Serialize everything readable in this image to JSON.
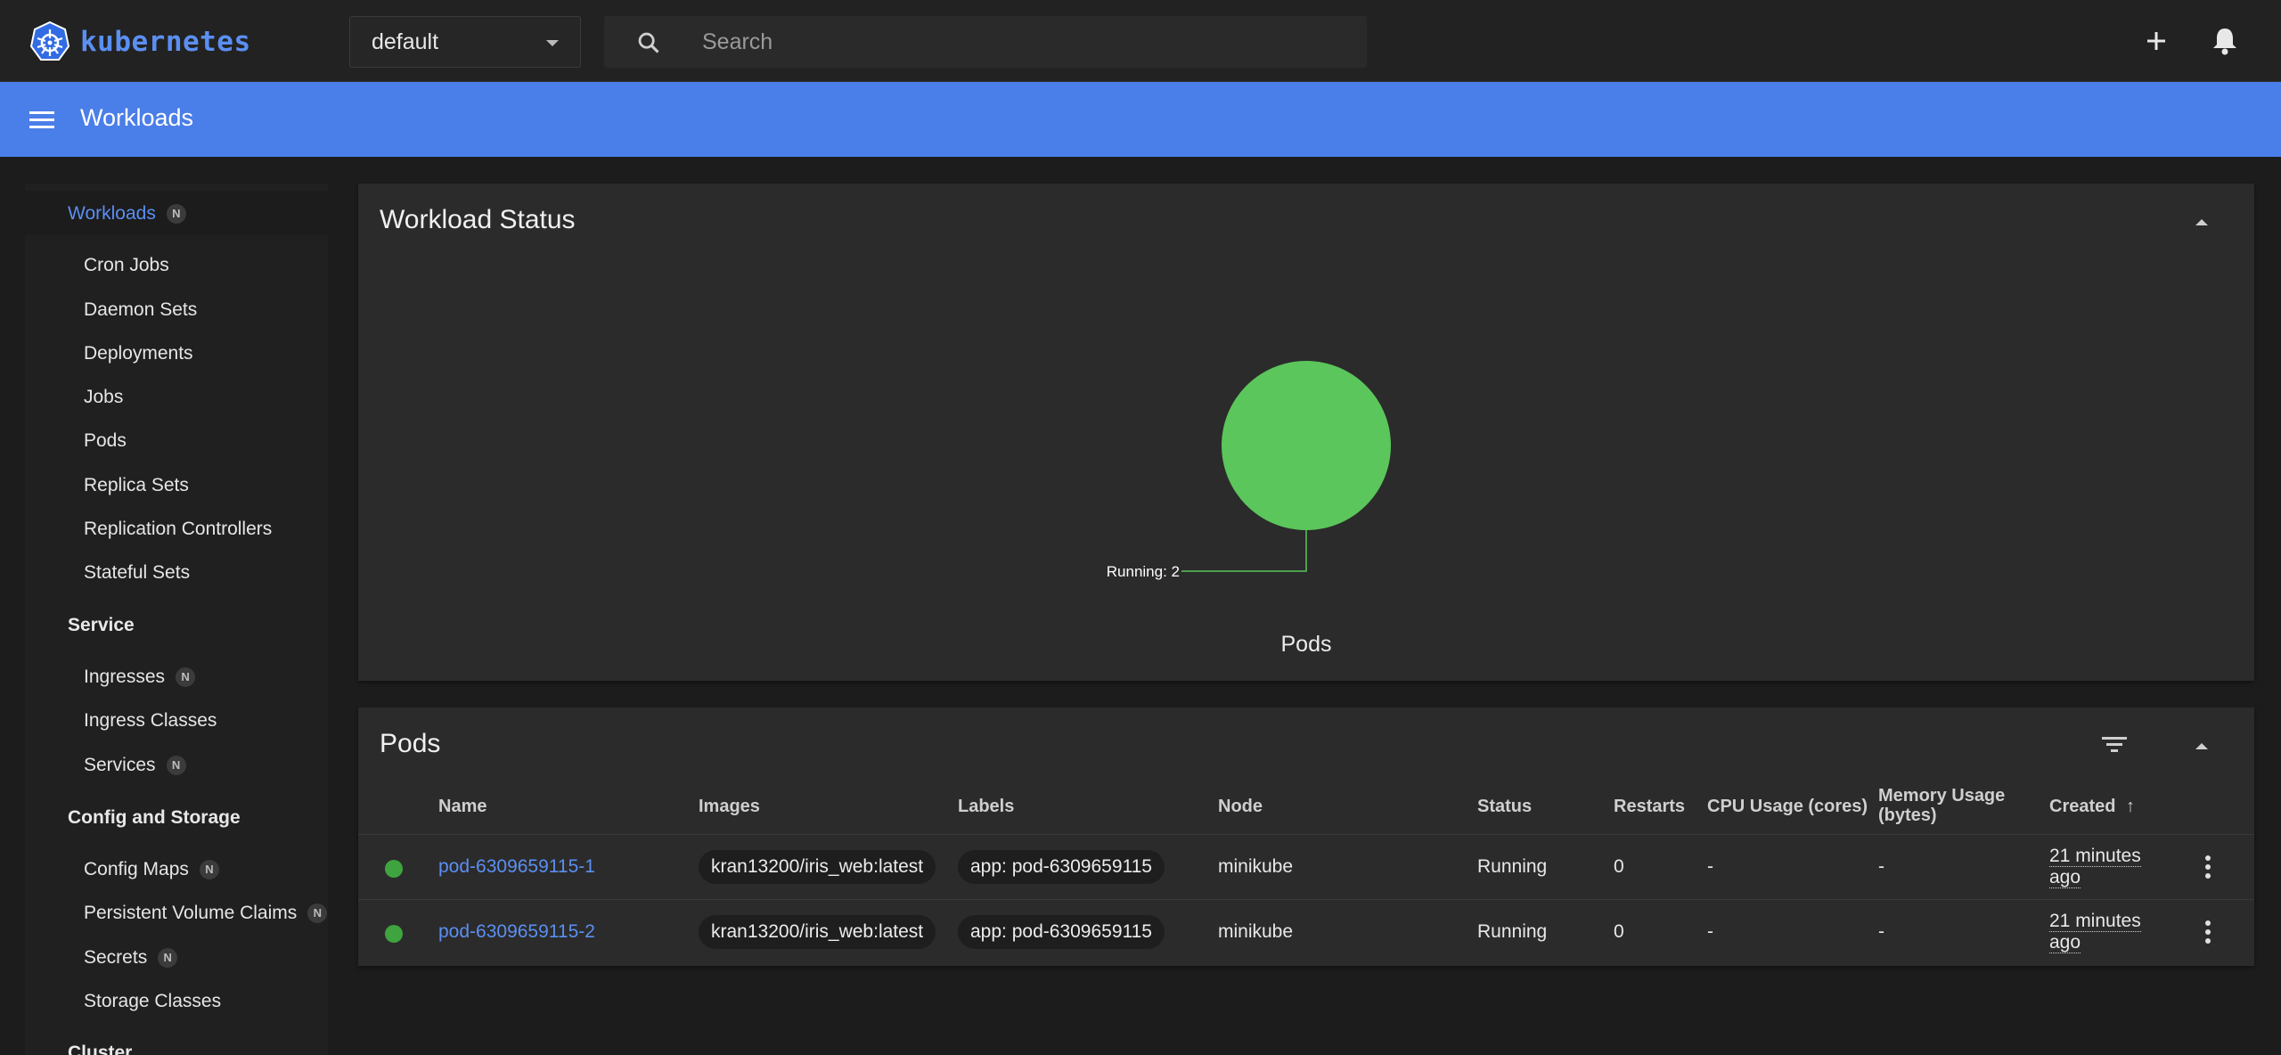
{
  "brand": {
    "name": "kubernetes",
    "color": "#5b8ff2"
  },
  "namespace": {
    "selected": "default"
  },
  "search": {
    "placeholder": "Search"
  },
  "titlebar": {
    "title": "Workloads",
    "color": "#4a7ee8"
  },
  "sidebar": {
    "sections": [
      {
        "title": "Workloads",
        "badge": "N",
        "active": true,
        "items": [
          {
            "label": "Cron Jobs"
          },
          {
            "label": "Daemon Sets"
          },
          {
            "label": "Deployments"
          },
          {
            "label": "Jobs"
          },
          {
            "label": "Pods"
          },
          {
            "label": "Replica Sets"
          },
          {
            "label": "Replication Controllers"
          },
          {
            "label": "Stateful Sets"
          }
        ]
      },
      {
        "title": "Service",
        "items": [
          {
            "label": "Ingresses",
            "badge": "N"
          },
          {
            "label": "Ingress Classes"
          },
          {
            "label": "Services",
            "badge": "N"
          }
        ]
      },
      {
        "title": "Config and Storage",
        "items": [
          {
            "label": "Config Maps",
            "badge": "N"
          },
          {
            "label": "Persistent Volume Claims",
            "badge": "N"
          },
          {
            "label": "Secrets",
            "badge": "N"
          },
          {
            "label": "Storage Classes"
          }
        ]
      },
      {
        "title": "Cluster",
        "items": []
      }
    ]
  },
  "workload_status": {
    "title": "Workload Status",
    "chart_data": {
      "type": "pie",
      "title": "Pods",
      "slices": [
        {
          "label": "Running",
          "value": 2,
          "color": "#5bc65b"
        }
      ],
      "annotation": "Running: 2"
    }
  },
  "pods": {
    "title": "Pods",
    "columns": [
      "Name",
      "Images",
      "Labels",
      "Node",
      "Status",
      "Restarts",
      "CPU Usage (cores)",
      "Memory Usage (bytes)",
      "Created"
    ],
    "memory_col": [
      "Memory Usage",
      "(bytes)"
    ],
    "sort_indicator": "↑",
    "rows": [
      {
        "name": "pod-6309659115-1",
        "image": "kran13200/iris_web:latest",
        "label": "app: pod-6309659115",
        "node": "minikube",
        "status": "Running",
        "restarts": "0",
        "cpu": "-",
        "memory": "-",
        "created": [
          "21 minutes",
          "ago"
        ],
        "status_color": "#3fa33f"
      },
      {
        "name": "pod-6309659115-2",
        "image": "kran13200/iris_web:latest",
        "label": "app: pod-6309659115",
        "node": "minikube",
        "status": "Running",
        "restarts": "0",
        "cpu": "-",
        "memory": "-",
        "created": [
          "21 minutes",
          "ago"
        ],
        "status_color": "#3fa33f"
      }
    ]
  }
}
